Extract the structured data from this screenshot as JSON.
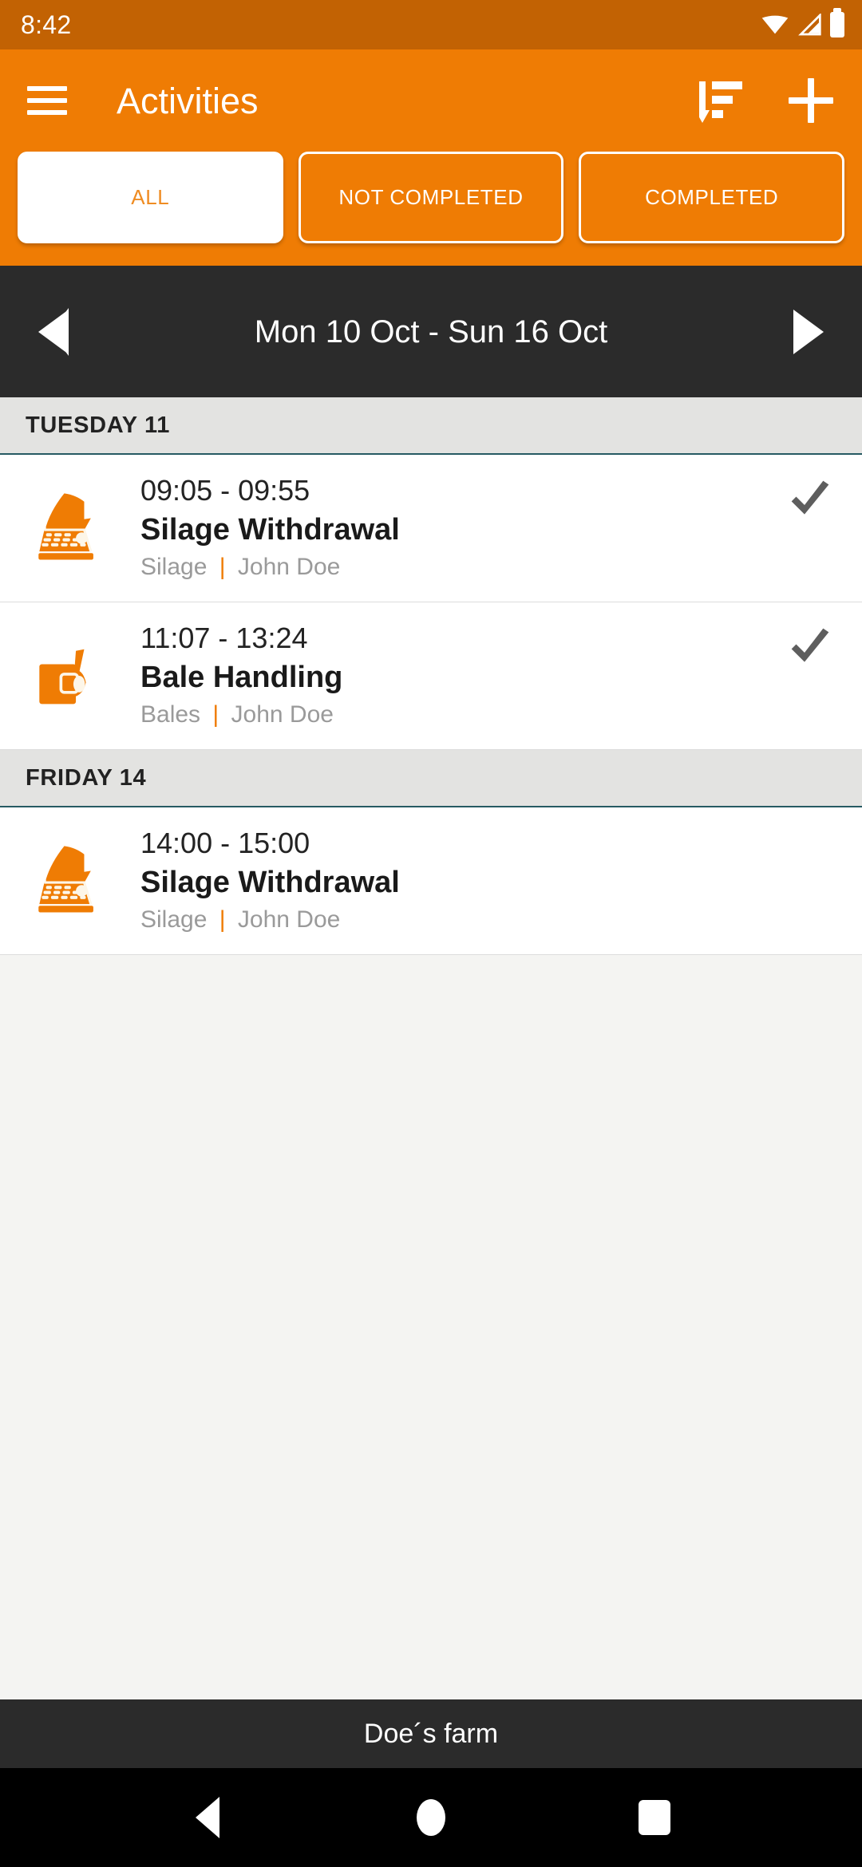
{
  "status_bar": {
    "time": "8:42",
    "icons": [
      "wifi-icon",
      "signal-icon",
      "battery-icon"
    ]
  },
  "app_bar": {
    "title": "Activities",
    "menu_icon": "hamburger-menu-icon",
    "sort_icon": "sort-descending-icon",
    "add_icon": "plus-icon"
  },
  "filters": [
    {
      "label": "ALL",
      "selected": true
    },
    {
      "label": "NOT COMPLETED",
      "selected": false
    },
    {
      "label": "COMPLETED",
      "selected": false
    }
  ],
  "week_nav": {
    "prev_icon": "chevron-left-icon",
    "next_icon": "chevron-right-icon",
    "range": "Mon 10 Oct - Sun 16 Oct"
  },
  "days": [
    {
      "header": "TUESDAY 11",
      "activities": [
        {
          "time": "09:05 - 09:55",
          "title": "Silage Withdrawal",
          "category": "Silage",
          "separator": "|",
          "person": "John Doe",
          "icon": "silage-block-cutter-icon",
          "completed": true
        },
        {
          "time": "11:07 - 13:24",
          "title": "Bale Handling",
          "category": "Bales",
          "separator": "|",
          "person": "John Doe",
          "icon": "bale-grab-icon",
          "completed": true
        }
      ]
    },
    {
      "header": "FRIDAY 14",
      "activities": [
        {
          "time": "14:00 - 15:00",
          "title": "Silage Withdrawal",
          "category": "Silage",
          "separator": "|",
          "person": "John Doe",
          "icon": "silage-block-cutter-icon",
          "completed": false
        }
      ]
    }
  ],
  "footer": {
    "farm_name": "Doe´s farm"
  },
  "android_nav": {
    "back": "back-triangle-icon",
    "home": "home-circle-icon",
    "recents": "recents-square-icon"
  },
  "colors": {
    "primary": "#ef7c04",
    "primary_dark": "#c26203",
    "dark_bar": "#2b2b2b",
    "day_header_bg": "#e3e3e1",
    "day_header_border": "#265a63",
    "check_gray": "#5e5e5e",
    "meta_gray": "#9a9a9a",
    "page_bg": "#f4f4f2"
  }
}
